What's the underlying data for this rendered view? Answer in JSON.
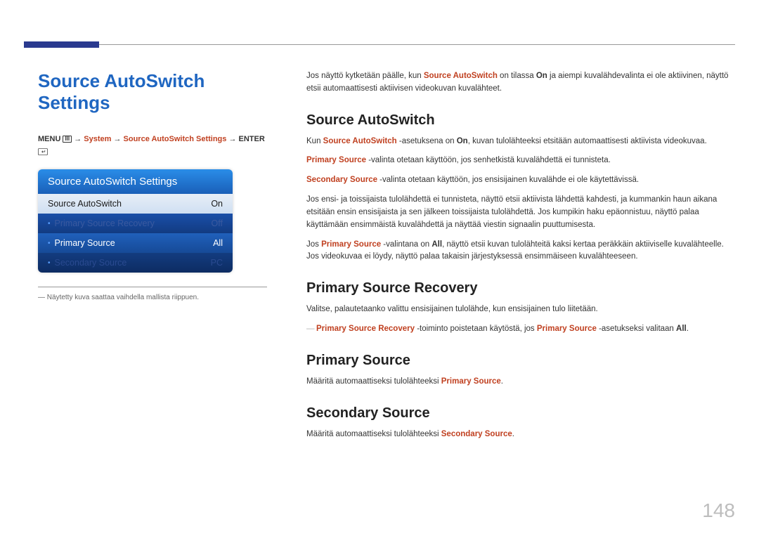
{
  "page_number": "148",
  "title": "Source AutoSwitch Settings",
  "nav_path": {
    "menu": "MENU",
    "arrow": " → ",
    "system": "System",
    "settings": "Source AutoSwitch Settings",
    "enter": "ENTER"
  },
  "osd": {
    "header": "Source AutoSwitch Settings",
    "rows": [
      {
        "label": "Source AutoSwitch",
        "value": "On"
      },
      {
        "label": "Primary Source Recovery",
        "value": "Off"
      },
      {
        "label": "Primary Source",
        "value": "All"
      },
      {
        "label": "Secondary Source",
        "value": "PC"
      }
    ]
  },
  "footnote_prefix": "― ",
  "footnote": "Näytetty kuva saattaa vaihdella mallista riippuen.",
  "intro": {
    "p1_a": "Jos näyttö kytketään päälle, kun ",
    "p1_b": "Source AutoSwitch",
    "p1_c": " on tilassa ",
    "p1_d": "On",
    "p1_e": " ja aiempi kuvalähdevalinta ei ole aktiivinen, näyttö etsii automaattisesti aktiivisen videokuvan kuvalähteet."
  },
  "sec_autoswitch": {
    "heading": "Source AutoSwitch",
    "p1_a": "Kun ",
    "p1_b": "Source AutoSwitch",
    "p1_c": " -asetuksena on ",
    "p1_d": "On",
    "p1_e": ", kuvan tulolähteeksi etsitään automaattisesti aktiivista videokuvaa.",
    "p2_a": "Primary Source",
    "p2_b": " -valinta otetaan käyttöön, jos senhetkistä kuvalähdettä ei tunnisteta.",
    "p3_a": "Secondary Source",
    "p3_b": " -valinta otetaan käyttöön, jos ensisijainen kuvalähde ei ole käytettävissä.",
    "p4": "Jos ensi- ja toissijaista tulolähdettä ei tunnisteta, näyttö etsii aktiivista lähdettä kahdesti, ja kummankin haun aikana etsitään ensin ensisijaista ja sen jälkeen toissijaista tulolähdettä. Jos kumpikin haku epäonnistuu, näyttö palaa käyttämään ensimmäistä kuvalähdettä ja näyttää viestin signaalin puuttumisesta.",
    "p5_a": "Jos ",
    "p5_b": "Primary Source",
    "p5_c": " -valintana on ",
    "p5_d": "All",
    "p5_e": ", näyttö etsii kuvan tulolähteitä kaksi kertaa peräkkäin aktiiviselle kuvalähteelle. Jos videokuvaa ei löydy, näyttö palaa takaisin järjestyksessä ensimmäiseen kuvalähteeseen."
  },
  "sec_recovery": {
    "heading": "Primary Source Recovery",
    "p1": "Valitse, palautetaanko valittu ensisijainen tulolähde, kun ensisijainen tulo liitetään.",
    "note_a": "Primary Source Recovery",
    "note_b": " -toiminto poistetaan käytöstä, jos ",
    "note_c": "Primary Source",
    "note_d": " -asetukseksi valitaan ",
    "note_e": "All",
    "note_f": "."
  },
  "sec_primary": {
    "heading": "Primary Source",
    "p1_a": "Määritä automaattiseksi tulolähteeksi ",
    "p1_b": "Primary Source",
    "p1_c": "."
  },
  "sec_secondary": {
    "heading": "Secondary Source",
    "p1_a": "Määritä automaattiseksi tulolähteeksi ",
    "p1_b": "Secondary Source",
    "p1_c": "."
  }
}
